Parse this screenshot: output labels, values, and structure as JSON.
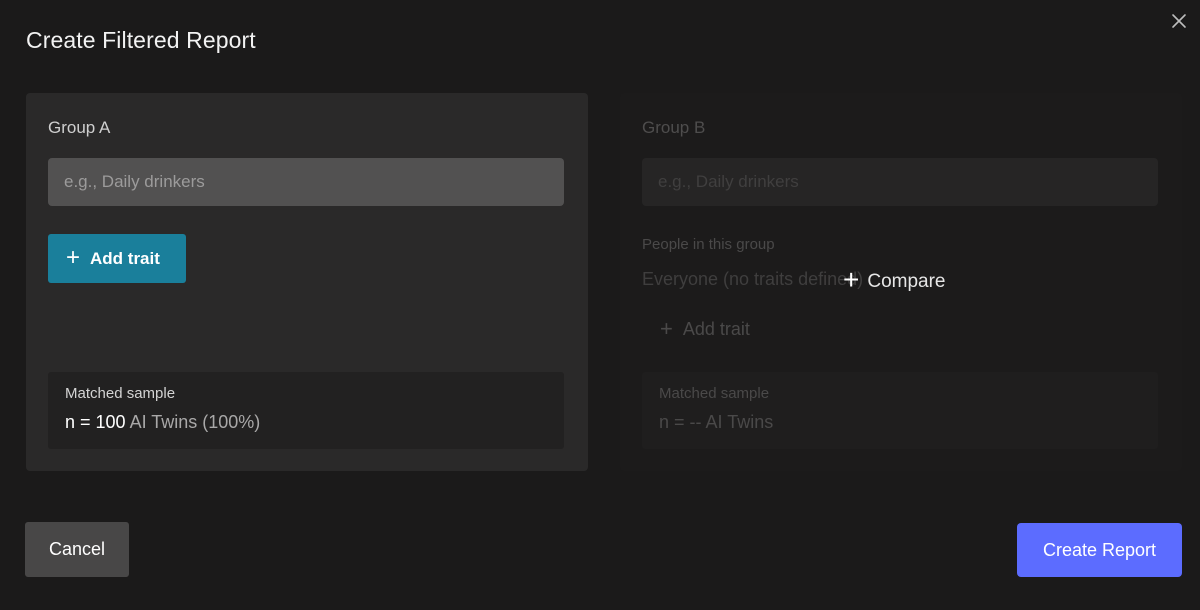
{
  "dialog": {
    "title": "Create Filtered Report",
    "close_icon": "close-icon"
  },
  "group_a": {
    "label": "Group A",
    "name_placeholder": "e.g., Daily drinkers",
    "name_value": "",
    "add_trait_label": "Add trait",
    "matched_sample": {
      "label": "Matched sample",
      "n_text": "n = 100",
      "detail": "AI Twins (100%)"
    }
  },
  "group_b": {
    "label": "Group B",
    "name_placeholder": "e.g., Daily drinkers",
    "name_value": "",
    "people_label": "People in this group",
    "people_value": "Everyone (no traits defined)",
    "add_trait_label": "Add trait",
    "matched_sample": {
      "label": "Matched sample",
      "value": "n = -- AI Twins"
    },
    "compare_label": "Compare"
  },
  "footer": {
    "cancel_label": "Cancel",
    "create_label": "Create Report"
  },
  "colors": {
    "background": "#1b1a1a",
    "panel_active": "#2a2929",
    "add_trait_accent": "#1a7f9b",
    "primary_button": "#5c6cff"
  }
}
